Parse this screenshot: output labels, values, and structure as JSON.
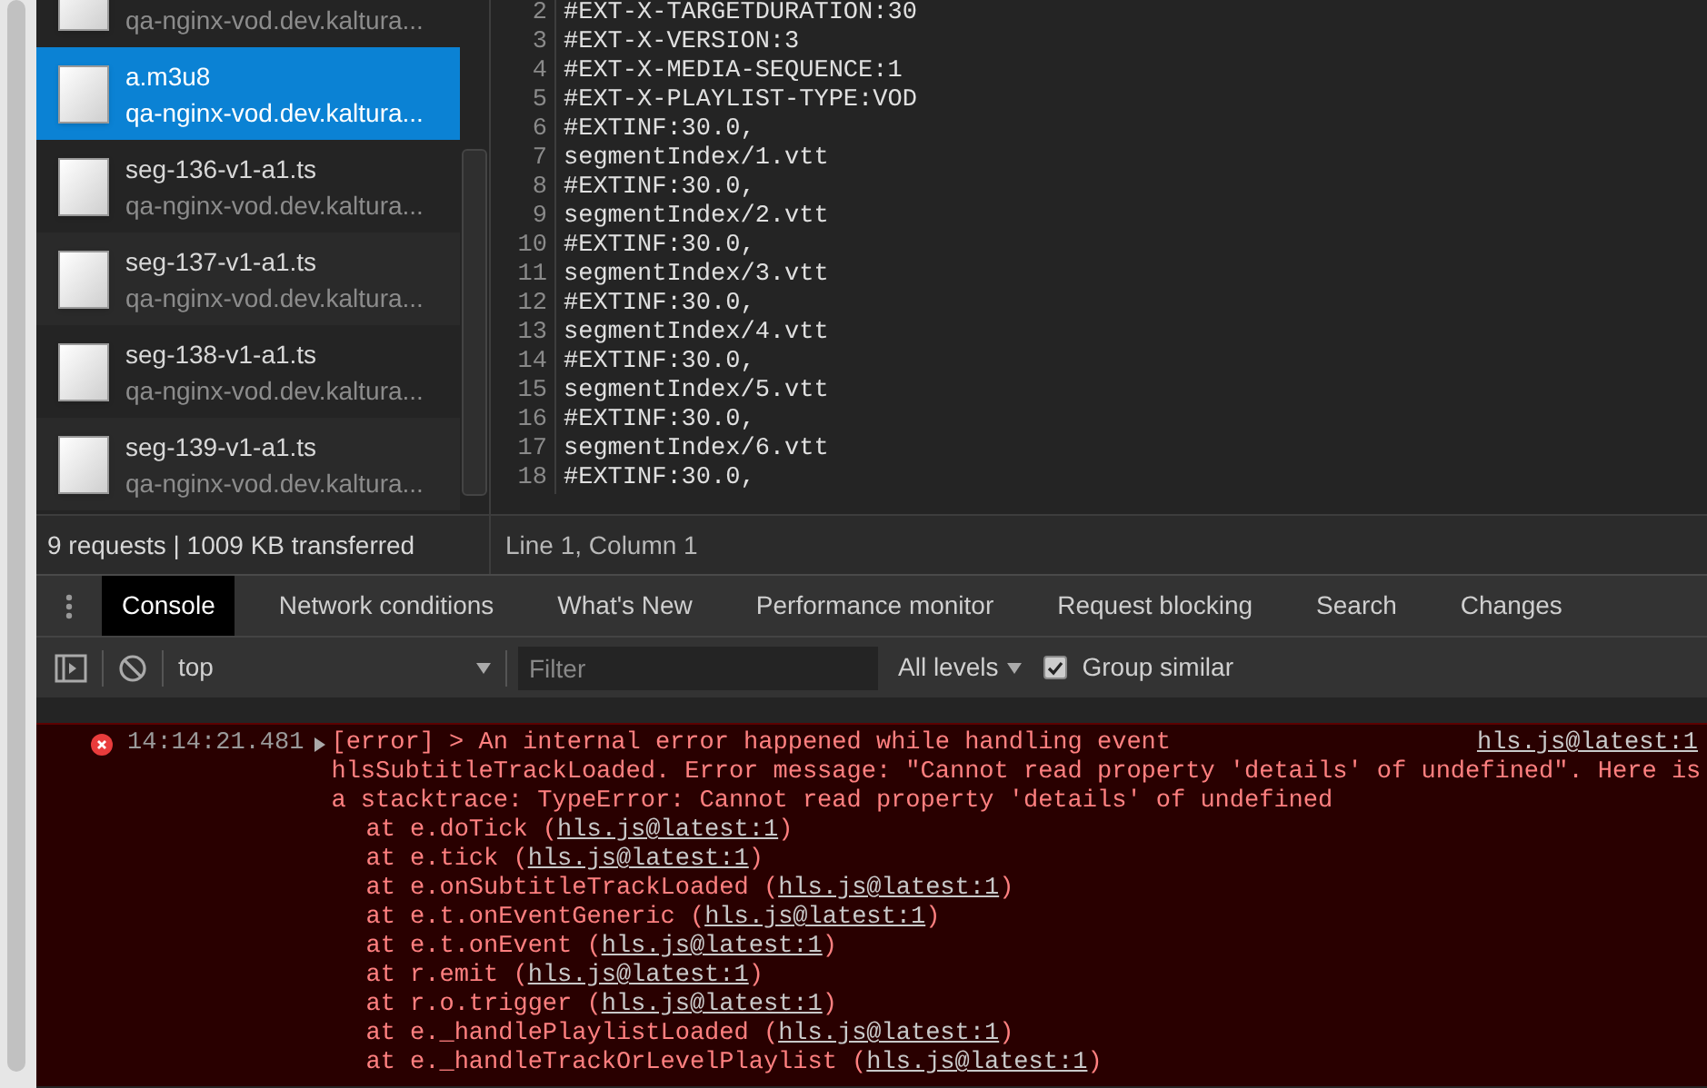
{
  "requests": [
    {
      "url": "qa-nginx-vod.dev.kaltura...",
      "selected": false
    },
    {
      "name": "a.m3u8",
      "url": "qa-nginx-vod.dev.kaltura...",
      "selected": true
    },
    {
      "name": "seg-136-v1-a1.ts",
      "url": "qa-nginx-vod.dev.kaltura...",
      "selected": false
    },
    {
      "name": "seg-137-v1-a1.ts",
      "url": "qa-nginx-vod.dev.kaltura...",
      "selected": false
    },
    {
      "name": "seg-138-v1-a1.ts",
      "url": "qa-nginx-vod.dev.kaltura...",
      "selected": false
    },
    {
      "name": "seg-139-v1-a1.ts",
      "url": "qa-nginx-vod.dev.kaltura...",
      "selected": false
    }
  ],
  "requests_summary": "9 requests | 1009 KB transferred",
  "editor": {
    "lines": [
      {
        "number": "2",
        "text": "#EXT-X-TARGETDURATION:30"
      },
      {
        "number": "3",
        "text": "#EXT-X-VERSION:3"
      },
      {
        "number": "4",
        "text": "#EXT-X-MEDIA-SEQUENCE:1"
      },
      {
        "number": "5",
        "text": "#EXT-X-PLAYLIST-TYPE:VOD"
      },
      {
        "number": "6",
        "text": "#EXTINF:30.0,"
      },
      {
        "number": "7",
        "text": "segmentIndex/1.vtt"
      },
      {
        "number": "8",
        "text": "#EXTINF:30.0,"
      },
      {
        "number": "9",
        "text": "segmentIndex/2.vtt"
      },
      {
        "number": "10",
        "text": "#EXTINF:30.0,"
      },
      {
        "number": "11",
        "text": "segmentIndex/3.vtt"
      },
      {
        "number": "12",
        "text": "#EXTINF:30.0,"
      },
      {
        "number": "13",
        "text": "segmentIndex/4.vtt"
      },
      {
        "number": "14",
        "text": "#EXTINF:30.0,"
      },
      {
        "number": "15",
        "text": "segmentIndex/5.vtt"
      },
      {
        "number": "16",
        "text": "#EXTINF:30.0,"
      },
      {
        "number": "17",
        "text": "segmentIndex/6.vtt"
      },
      {
        "number": "18",
        "text": "#EXTINF:30.0,"
      }
    ],
    "status": "Line 1, Column 1"
  },
  "drawer_tabs": [
    {
      "label": "Console",
      "selected": true
    },
    {
      "label": "Network conditions",
      "selected": false
    },
    {
      "label": "What's New",
      "selected": false
    },
    {
      "label": "Performance monitor",
      "selected": false
    },
    {
      "label": "Request blocking",
      "selected": false
    },
    {
      "label": "Search",
      "selected": false
    },
    {
      "label": "Changes",
      "selected": false
    }
  ],
  "toolbar": {
    "context": "top",
    "filter_placeholder": "Filter",
    "levels": "All levels",
    "group_similar": {
      "label": "Group similar",
      "checked": true
    }
  },
  "console": [
    {
      "kind": "error",
      "time": "14:14:21.481",
      "source": "hls.js@latest:1",
      "message": [
        "[error] > An internal error happened while handling event",
        "hlsSubtitleTrackLoaded. Error message: \"Cannot read property 'details' of undefined\". Here is",
        "a stacktrace: TypeError: Cannot read property 'details' of undefined"
      ],
      "stack": [
        {
          "text": "at e.doTick (",
          "link": "hls.js@latest:1",
          "end": ")"
        },
        {
          "text": "at e.tick (",
          "link": "hls.js@latest:1",
          "end": ")"
        },
        {
          "text": "at e.onSubtitleTrackLoaded (",
          "link": "hls.js@latest:1",
          "end": ")"
        },
        {
          "text": "at e.t.onEventGeneric (",
          "link": "hls.js@latest:1",
          "end": ")"
        },
        {
          "text": "at e.t.onEvent (",
          "link": "hls.js@latest:1",
          "end": ")"
        },
        {
          "text": "at r.emit (",
          "link": "hls.js@latest:1",
          "end": ")"
        },
        {
          "text": "at r.o.trigger (",
          "link": "hls.js@latest:1",
          "end": ")"
        },
        {
          "text": "at e._handlePlaylistLoaded (",
          "link": "hls.js@latest:1",
          "end": ")"
        },
        {
          "text": "at e._handleTrackOrLevelPlaylist (",
          "link": "hls.js@latest:1",
          "end": ")"
        }
      ]
    }
  ]
}
